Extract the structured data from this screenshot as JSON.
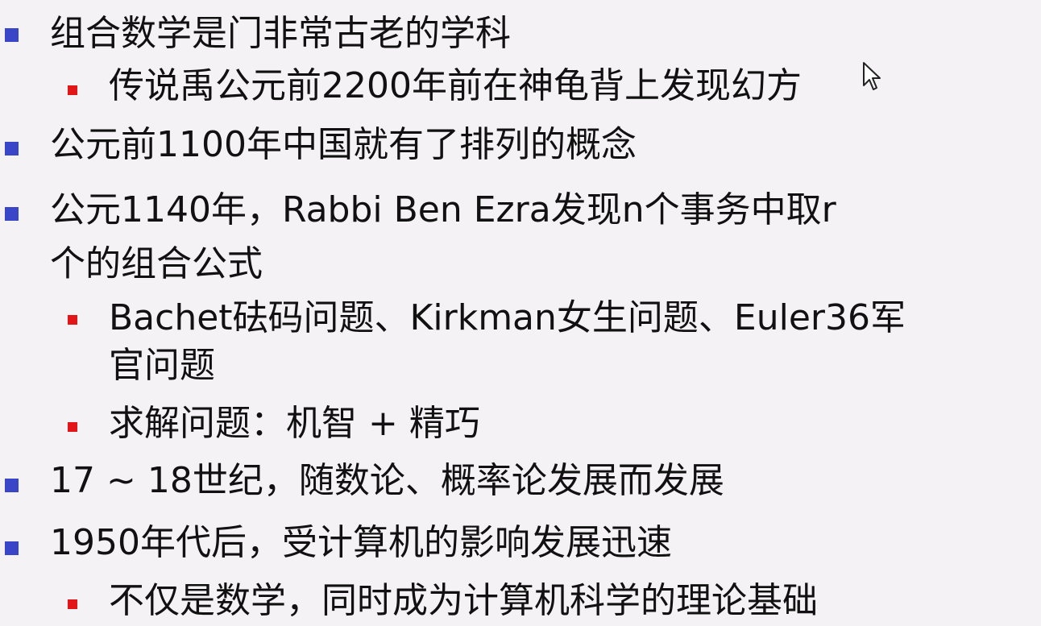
{
  "slide": {
    "items": [
      {
        "level": 1,
        "lines": [
          "组合数学是门非常古老的学科"
        ]
      },
      {
        "level": 2,
        "lines": [
          "传说禹公元前2200年前在神龟背上发现幻方"
        ]
      },
      {
        "level": 1,
        "lines": [
          "公元前1100年中国就有了排列的概念"
        ]
      },
      {
        "level": 1,
        "lines": [
          "公元1140年，Rabbi Ben Ezra发现n个事务中取r",
          "个的组合公式"
        ]
      },
      {
        "level": 2,
        "lines": [
          "Bachet砝码问题、Kirkman女生问题、Euler36军",
          "官问题"
        ]
      },
      {
        "level": 2,
        "lines": [
          "求解问题：机智 + 精巧"
        ]
      },
      {
        "level": 1,
        "lines": [
          "17 ~ 18世纪，随数论、概率论发展而发展"
        ]
      },
      {
        "level": 1,
        "lines": [
          "1950年代后，受计算机的影响发展迅速"
        ]
      },
      {
        "level": 2,
        "lines": [
          "不仅是数学，同时成为计算机科学的理论基础"
        ]
      }
    ]
  },
  "colors": {
    "background": "#f4f2f4",
    "text": "#111111",
    "level1_bullet": "#3a46c8",
    "level2_bullet": "#e21616"
  },
  "icons": {
    "cursor": "mouse-cursor-icon"
  }
}
